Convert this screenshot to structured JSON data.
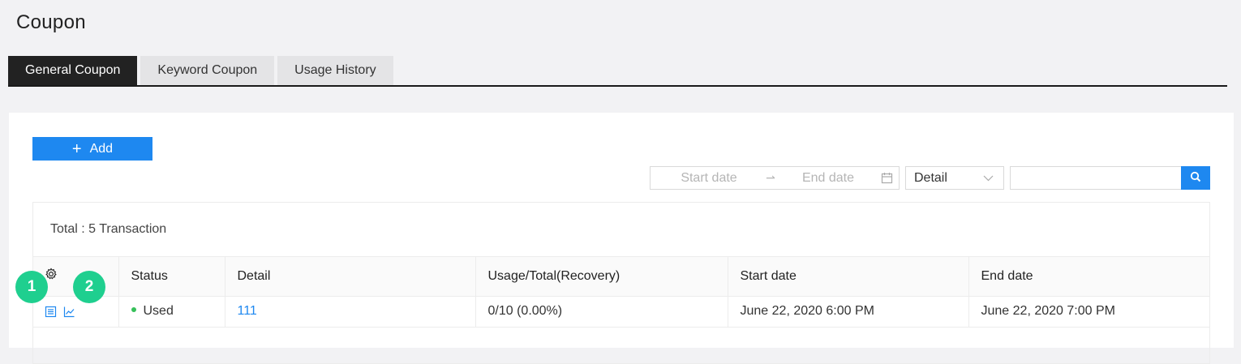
{
  "page": {
    "title": "Coupon"
  },
  "tabs": [
    {
      "label": "General Coupon",
      "active": true
    },
    {
      "label": "Keyword Coupon",
      "active": false
    },
    {
      "label": "Usage History",
      "active": false
    }
  ],
  "toolbar": {
    "add_label": "Add",
    "add_icon": "plus-icon",
    "start_placeholder": "Start date",
    "end_placeholder": "End date",
    "filter_selected": "Detail",
    "search_value": ""
  },
  "table": {
    "total_text": "Total : 5 Transaction",
    "columns": [
      "Status",
      "Detail",
      "Usage/Total(Recovery)",
      "Start date",
      "End date"
    ],
    "rows": [
      {
        "status": "Used",
        "detail": "111",
        "usage": "0/10 (0.00%)",
        "start": "June 22, 2020 6:00 PM",
        "end": "June 22, 2020 7:00 PM"
      }
    ]
  },
  "badges": [
    "1",
    "2"
  ],
  "colors": {
    "accent": "#1e88f0",
    "active_tab": "#222222",
    "status_used": "#36c05a",
    "badge": "#1fcf8f"
  }
}
